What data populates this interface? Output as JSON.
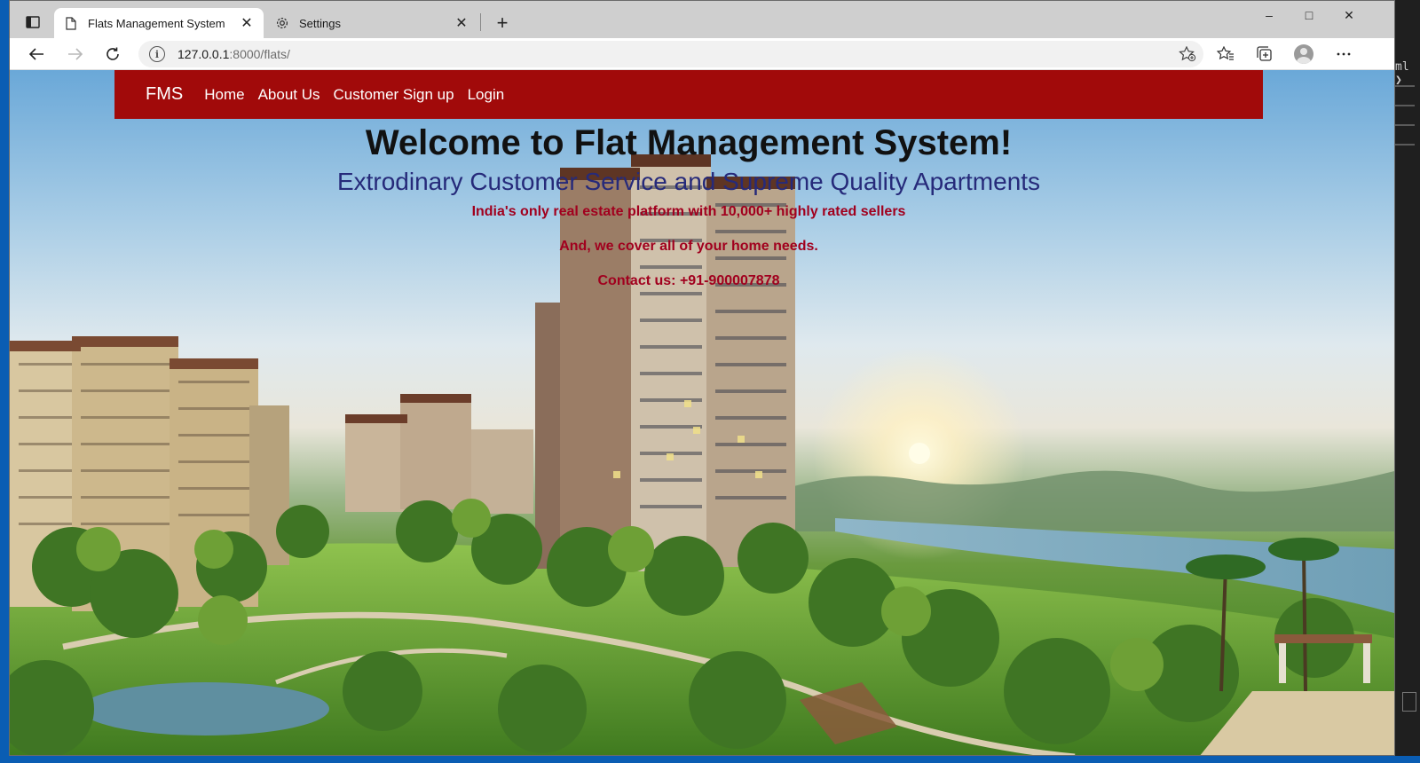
{
  "browser": {
    "tabs": [
      {
        "title": "Flats Management System",
        "icon": "page-icon",
        "active": true
      },
      {
        "title": "Settings",
        "icon": "gear-icon",
        "active": false
      }
    ],
    "new_tab": "+",
    "window_controls": {
      "minimize": "–",
      "maximize": "□",
      "close": "✕"
    },
    "address": {
      "host": "127.0.0.1",
      "path": ":8000/flats/"
    },
    "tab_close": "✕"
  },
  "site": {
    "brand": "FMS",
    "nav": [
      "Home",
      "About Us",
      "Customer Sign up",
      "Login"
    ],
    "navbar_color": "#a10a0a"
  },
  "hero": {
    "title": "Welcome to Flat Management System!",
    "subtitle": "Extrodinary Customer Service and Supreme Quality Apartments",
    "line1": "India's only real estate platform with 10,000+ highly rated sellers",
    "line2": "And, we cover all of your home needs.",
    "line3": "Contact us: +91-900007878"
  },
  "desktop": {
    "side_text": "ml ❯"
  }
}
